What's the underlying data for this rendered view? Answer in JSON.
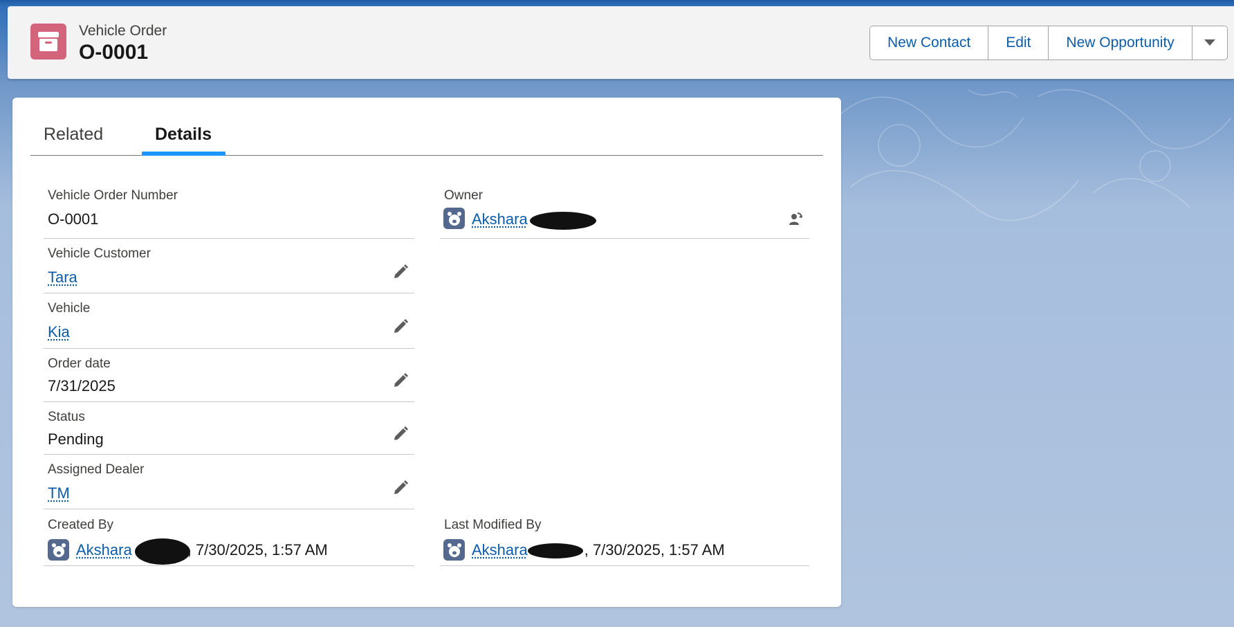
{
  "header": {
    "object_label": "Vehicle Order",
    "record_name": "O-0001",
    "buttons": [
      {
        "label": "New Contact"
      },
      {
        "label": "Edit"
      },
      {
        "label": "New Opportunity"
      }
    ],
    "icon": "archive-box-icon"
  },
  "tabs": [
    {
      "label": "Related",
      "active": false
    },
    {
      "label": "Details",
      "active": true
    }
  ],
  "fields": {
    "order_number": {
      "label": "Vehicle Order Number",
      "value": "O-0001"
    },
    "owner": {
      "label": "Owner",
      "value": "Akshara"
    },
    "customer": {
      "label": "Vehicle Customer",
      "value": "Tara"
    },
    "vehicle": {
      "label": "Vehicle",
      "value": "Kia"
    },
    "order_date": {
      "label": "Order date",
      "value": "7/31/2025"
    },
    "status": {
      "label": "Status",
      "value": "Pending"
    },
    "dealer": {
      "label": "Assigned Dealer",
      "value": "TM"
    },
    "created_by": {
      "label": "Created By",
      "user": "Akshara",
      "timestamp": ", 7/30/2025, 1:57 AM"
    },
    "modified_by": {
      "label": "Last Modified By",
      "user": "Akshara",
      "timestamp": ", 7/30/2025, 1:57 AM"
    }
  },
  "colors": {
    "link": "#0b5cab",
    "object_icon": "#d4647c",
    "active_tab": "#1b96ff",
    "avatar": "#54698d"
  }
}
